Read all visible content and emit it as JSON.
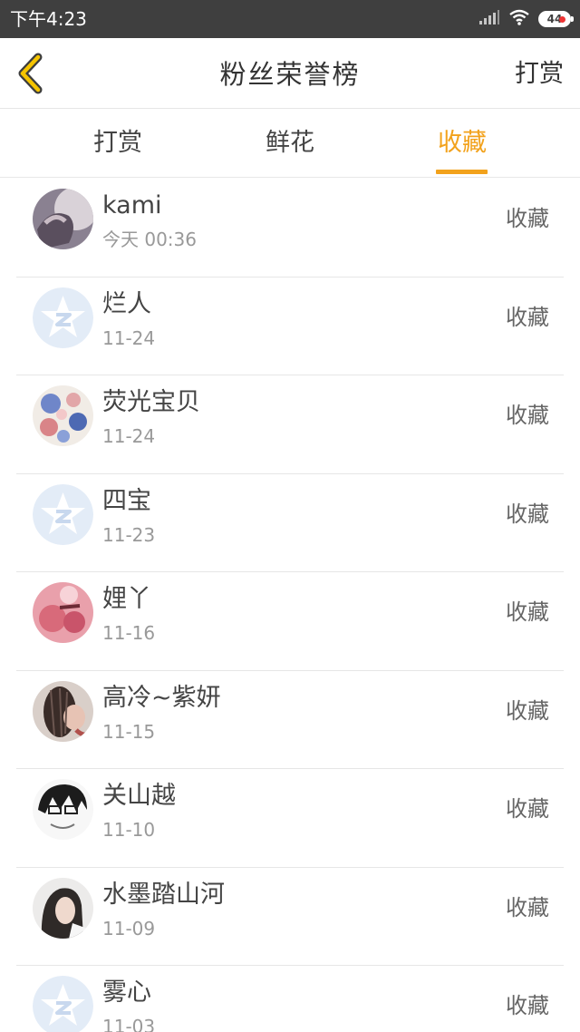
{
  "status_bar": {
    "time": "下午4:23",
    "battery": "44",
    "signal_icon": "signal-icon",
    "wifi_icon": "wifi-icon"
  },
  "header": {
    "title": "粉丝荣誉榜",
    "right_action": "打赏",
    "back_icon": "chevron-left-icon"
  },
  "tabs": [
    {
      "label": "打赏",
      "active": false
    },
    {
      "label": "鲜花",
      "active": false
    },
    {
      "label": "收藏",
      "active": true
    }
  ],
  "colors": {
    "accent": "#f2a21c",
    "status_bar": "#3f3f3f"
  },
  "fans": [
    {
      "name": "kami",
      "date": "今天 00:36",
      "action": "收藏",
      "avatar": "photo"
    },
    {
      "name": "烂人",
      "date": "11-24",
      "action": "收藏",
      "avatar": "default"
    },
    {
      "name": "荧光宝贝",
      "date": "11-24",
      "action": "收藏",
      "avatar": "photo"
    },
    {
      "name": "四宝",
      "date": "11-23",
      "action": "收藏",
      "avatar": "default"
    },
    {
      "name": "娌丫",
      "date": "11-16",
      "action": "收藏",
      "avatar": "photo"
    },
    {
      "name": "高冷~紫妍",
      "date": "11-15",
      "action": "收藏",
      "avatar": "photo"
    },
    {
      "name": "关山越",
      "date": "11-10",
      "action": "收藏",
      "avatar": "photo"
    },
    {
      "name": "水墨踏山河",
      "date": "11-09",
      "action": "收藏",
      "avatar": "photo"
    },
    {
      "name": "雾心",
      "date": "11-03",
      "action": "收藏",
      "avatar": "default"
    }
  ]
}
